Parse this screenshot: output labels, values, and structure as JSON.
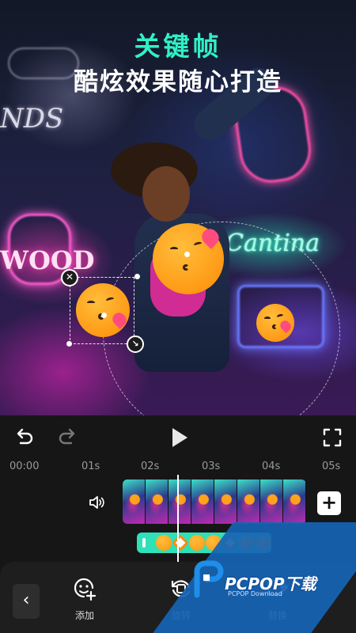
{
  "preview": {
    "title": "关键帧",
    "subtitle": "酷炫效果随心打造",
    "neon_signs": [
      "Cantina",
      "WOOD",
      "NDS"
    ]
  },
  "controls": {
    "undo_icon": "undo-icon",
    "redo_icon": "redo-icon",
    "play_icon": "play-icon",
    "fullscreen_icon": "fullscreen-icon"
  },
  "timeline": {
    "ticks": [
      "00:00",
      "01s",
      "02s",
      "03s",
      "04s",
      "05s"
    ],
    "add_clip_label": "+",
    "volume_icon": "volume-icon",
    "video_frames": 8,
    "sticker_items": 8
  },
  "toolbar": {
    "back_label": "‹",
    "tools": [
      {
        "label": "添加",
        "icon": "add-sticker-icon"
      },
      {
        "label": "旋转",
        "icon": "rotate-icon"
      },
      {
        "label": "替换",
        "icon": "replace-icon"
      }
    ]
  },
  "watermark": {
    "brand": "PCPOP下载",
    "sub": "PCPOP Download"
  },
  "colors": {
    "accent_teal": "#31f0c6",
    "sticker_track": "#2fe0b8",
    "panel_bg": "#161616",
    "watermark_blue": "#1664b4"
  }
}
